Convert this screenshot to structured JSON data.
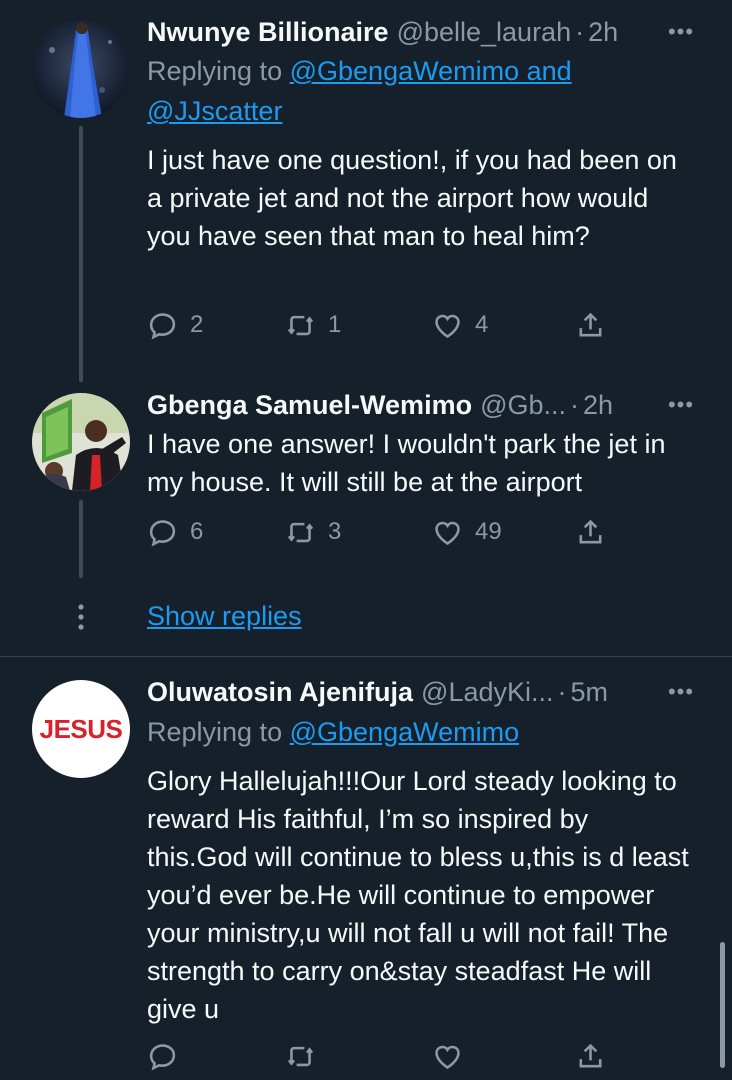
{
  "tweets": [
    {
      "name": "Nwunye Billionaire",
      "handle": "@belle_laurah",
      "time": "2h",
      "replying_label": "Replying to",
      "replying_to": "@GbengaWemimo and",
      "replying_to_2": "@JJscatter",
      "text": "I just have one question!, if you had been on a private jet and not the airport how would you have seen that man to heal him?",
      "replies": "2",
      "retweets": "1",
      "likes": "4"
    },
    {
      "name": "Gbenga Samuel-Wemimo",
      "handle": "@Gb...",
      "time": "2h",
      "text": "I have one answer! I wouldn't park the jet in my house. It will still be at the airport",
      "replies": "6",
      "retweets": "3",
      "likes": "49"
    },
    {
      "name": "Oluwatosin Ajenifuja",
      "handle": "@LadyKi...",
      "time": "5m",
      "replying_label": "Replying to",
      "replying_to": "@GbengaWemimo",
      "avatar_text": "JESUS",
      "text": "Glory Hallelujah!!!Our Lord steady looking to reward His faithful, I’m so inspired by this.God will continue to bless u,this is d least you’d ever be.He will continue to empower your ministry,u will not fall u will not fail! The strength to carry on&stay steadfast He will give u",
      "replies": "",
      "retweets": "",
      "likes": ""
    }
  ],
  "show_replies": "Show replies",
  "separator": "·",
  "more_glyph": "•••",
  "icons": {
    "reply": "reply-icon",
    "retweet": "retweet-icon",
    "like": "heart-icon",
    "share": "share-icon"
  },
  "colors": {
    "background": "#15202b",
    "link": "#1d9bf0",
    "muted": "#8b98a5",
    "accent_red": "#d8222a"
  }
}
